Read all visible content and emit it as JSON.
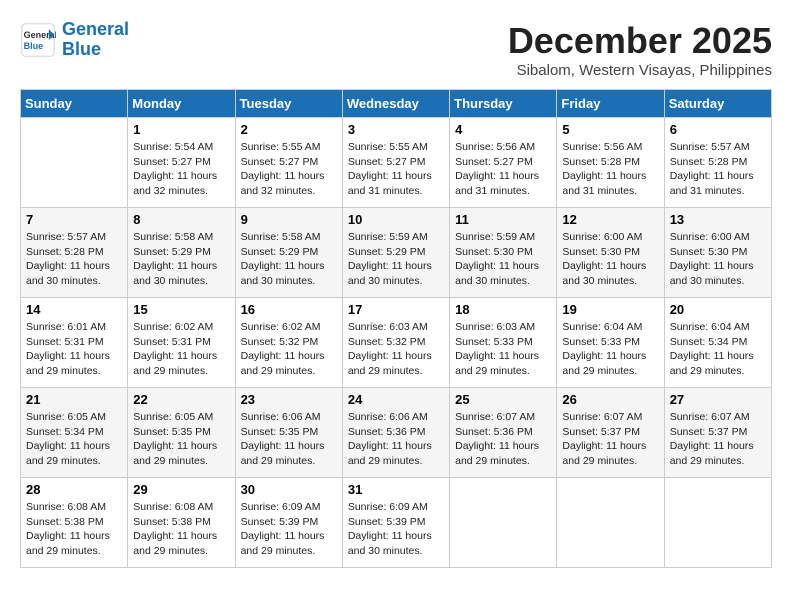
{
  "header": {
    "logo_line1": "General",
    "logo_line2": "Blue",
    "month": "December 2025",
    "location": "Sibalom, Western Visayas, Philippines"
  },
  "days_of_week": [
    "Sunday",
    "Monday",
    "Tuesday",
    "Wednesday",
    "Thursday",
    "Friday",
    "Saturday"
  ],
  "weeks": [
    [
      {
        "day": "",
        "sunrise": "",
        "sunset": "",
        "daylight": ""
      },
      {
        "day": "1",
        "sunrise": "Sunrise: 5:54 AM",
        "sunset": "Sunset: 5:27 PM",
        "daylight": "Daylight: 11 hours and 32 minutes."
      },
      {
        "day": "2",
        "sunrise": "Sunrise: 5:55 AM",
        "sunset": "Sunset: 5:27 PM",
        "daylight": "Daylight: 11 hours and 32 minutes."
      },
      {
        "day": "3",
        "sunrise": "Sunrise: 5:55 AM",
        "sunset": "Sunset: 5:27 PM",
        "daylight": "Daylight: 11 hours and 31 minutes."
      },
      {
        "day": "4",
        "sunrise": "Sunrise: 5:56 AM",
        "sunset": "Sunset: 5:27 PM",
        "daylight": "Daylight: 11 hours and 31 minutes."
      },
      {
        "day": "5",
        "sunrise": "Sunrise: 5:56 AM",
        "sunset": "Sunset: 5:28 PM",
        "daylight": "Daylight: 11 hours and 31 minutes."
      },
      {
        "day": "6",
        "sunrise": "Sunrise: 5:57 AM",
        "sunset": "Sunset: 5:28 PM",
        "daylight": "Daylight: 11 hours and 31 minutes."
      }
    ],
    [
      {
        "day": "7",
        "sunrise": "Sunrise: 5:57 AM",
        "sunset": "Sunset: 5:28 PM",
        "daylight": "Daylight: 11 hours and 30 minutes."
      },
      {
        "day": "8",
        "sunrise": "Sunrise: 5:58 AM",
        "sunset": "Sunset: 5:29 PM",
        "daylight": "Daylight: 11 hours and 30 minutes."
      },
      {
        "day": "9",
        "sunrise": "Sunrise: 5:58 AM",
        "sunset": "Sunset: 5:29 PM",
        "daylight": "Daylight: 11 hours and 30 minutes."
      },
      {
        "day": "10",
        "sunrise": "Sunrise: 5:59 AM",
        "sunset": "Sunset: 5:29 PM",
        "daylight": "Daylight: 11 hours and 30 minutes."
      },
      {
        "day": "11",
        "sunrise": "Sunrise: 5:59 AM",
        "sunset": "Sunset: 5:30 PM",
        "daylight": "Daylight: 11 hours and 30 minutes."
      },
      {
        "day": "12",
        "sunrise": "Sunrise: 6:00 AM",
        "sunset": "Sunset: 5:30 PM",
        "daylight": "Daylight: 11 hours and 30 minutes."
      },
      {
        "day": "13",
        "sunrise": "Sunrise: 6:00 AM",
        "sunset": "Sunset: 5:30 PM",
        "daylight": "Daylight: 11 hours and 30 minutes."
      }
    ],
    [
      {
        "day": "14",
        "sunrise": "Sunrise: 6:01 AM",
        "sunset": "Sunset: 5:31 PM",
        "daylight": "Daylight: 11 hours and 29 minutes."
      },
      {
        "day": "15",
        "sunrise": "Sunrise: 6:02 AM",
        "sunset": "Sunset: 5:31 PM",
        "daylight": "Daylight: 11 hours and 29 minutes."
      },
      {
        "day": "16",
        "sunrise": "Sunrise: 6:02 AM",
        "sunset": "Sunset: 5:32 PM",
        "daylight": "Daylight: 11 hours and 29 minutes."
      },
      {
        "day": "17",
        "sunrise": "Sunrise: 6:03 AM",
        "sunset": "Sunset: 5:32 PM",
        "daylight": "Daylight: 11 hours and 29 minutes."
      },
      {
        "day": "18",
        "sunrise": "Sunrise: 6:03 AM",
        "sunset": "Sunset: 5:33 PM",
        "daylight": "Daylight: 11 hours and 29 minutes."
      },
      {
        "day": "19",
        "sunrise": "Sunrise: 6:04 AM",
        "sunset": "Sunset: 5:33 PM",
        "daylight": "Daylight: 11 hours and 29 minutes."
      },
      {
        "day": "20",
        "sunrise": "Sunrise: 6:04 AM",
        "sunset": "Sunset: 5:34 PM",
        "daylight": "Daylight: 11 hours and 29 minutes."
      }
    ],
    [
      {
        "day": "21",
        "sunrise": "Sunrise: 6:05 AM",
        "sunset": "Sunset: 5:34 PM",
        "daylight": "Daylight: 11 hours and 29 minutes."
      },
      {
        "day": "22",
        "sunrise": "Sunrise: 6:05 AM",
        "sunset": "Sunset: 5:35 PM",
        "daylight": "Daylight: 11 hours and 29 minutes."
      },
      {
        "day": "23",
        "sunrise": "Sunrise: 6:06 AM",
        "sunset": "Sunset: 5:35 PM",
        "daylight": "Daylight: 11 hours and 29 minutes."
      },
      {
        "day": "24",
        "sunrise": "Sunrise: 6:06 AM",
        "sunset": "Sunset: 5:36 PM",
        "daylight": "Daylight: 11 hours and 29 minutes."
      },
      {
        "day": "25",
        "sunrise": "Sunrise: 6:07 AM",
        "sunset": "Sunset: 5:36 PM",
        "daylight": "Daylight: 11 hours and 29 minutes."
      },
      {
        "day": "26",
        "sunrise": "Sunrise: 6:07 AM",
        "sunset": "Sunset: 5:37 PM",
        "daylight": "Daylight: 11 hours and 29 minutes."
      },
      {
        "day": "27",
        "sunrise": "Sunrise: 6:07 AM",
        "sunset": "Sunset: 5:37 PM",
        "daylight": "Daylight: 11 hours and 29 minutes."
      }
    ],
    [
      {
        "day": "28",
        "sunrise": "Sunrise: 6:08 AM",
        "sunset": "Sunset: 5:38 PM",
        "daylight": "Daylight: 11 hours and 29 minutes."
      },
      {
        "day": "29",
        "sunrise": "Sunrise: 6:08 AM",
        "sunset": "Sunset: 5:38 PM",
        "daylight": "Daylight: 11 hours and 29 minutes."
      },
      {
        "day": "30",
        "sunrise": "Sunrise: 6:09 AM",
        "sunset": "Sunset: 5:39 PM",
        "daylight": "Daylight: 11 hours and 29 minutes."
      },
      {
        "day": "31",
        "sunrise": "Sunrise: 6:09 AM",
        "sunset": "Sunset: 5:39 PM",
        "daylight": "Daylight: 11 hours and 30 minutes."
      },
      {
        "day": "",
        "sunrise": "",
        "sunset": "",
        "daylight": ""
      },
      {
        "day": "",
        "sunrise": "",
        "sunset": "",
        "daylight": ""
      },
      {
        "day": "",
        "sunrise": "",
        "sunset": "",
        "daylight": ""
      }
    ]
  ]
}
